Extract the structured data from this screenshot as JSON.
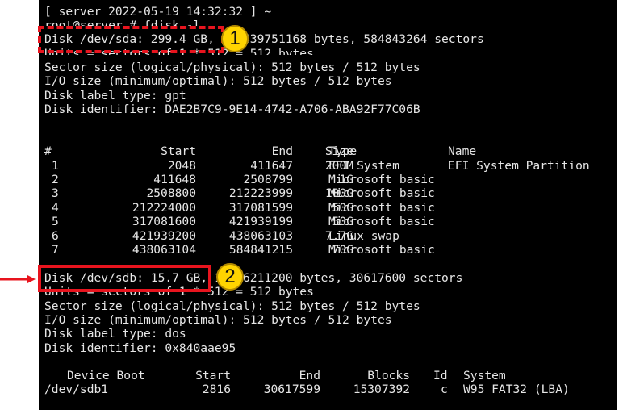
{
  "terminal": {
    "prompt_line": "[ server 2022-05-19 14:32:32 ] ~",
    "command_line": "root@server # fdisk -l",
    "sda": {
      "disk_line": "Disk /dev/sda: 299.4 GB, 299439751168 bytes, 584843264 sectors",
      "units_line": "Units = sectors of 1 * 512 = 512 bytes",
      "sector_size_line": "Sector size (logical/physical): 512 bytes / 512 bytes",
      "io_size_line": "I/O size (minimum/optimal): 512 bytes / 512 bytes",
      "label_type_line": "Disk label type: gpt",
      "identifier_line": "Disk identifier: DAE2B7C9-9E14-4742-A706-ABA92F77C06B"
    },
    "partition_table": {
      "headers": [
        "#",
        "Start",
        "End",
        "Size",
        "Type",
        "Name"
      ],
      "rows": [
        [
          "1",
          "2048",
          "411647",
          "200M",
          "EFI System",
          "EFI System Partition"
        ],
        [
          "2",
          "411648",
          "2508799",
          "1G",
          "Microsoft basic",
          ""
        ],
        [
          "3",
          "2508800",
          "212223999",
          "100G",
          "Microsoft basic",
          ""
        ],
        [
          "4",
          "212224000",
          "317081599",
          "50G",
          "Microsoft basic",
          ""
        ],
        [
          "5",
          "317081600",
          "421939199",
          "50G",
          "Microsoft basic",
          ""
        ],
        [
          "6",
          "421939200",
          "438063103",
          "7.7G",
          "Linux swap",
          ""
        ],
        [
          "7",
          "438063104",
          "584841215",
          "70G",
          "Microsoft basic",
          ""
        ]
      ]
    },
    "sdb": {
      "disk_line": "Disk /dev/sdb: 15.7 GB, 15676211200 bytes, 30617600 sectors",
      "units_line": "Units = sectors of 1 * 512 = 512 bytes",
      "sector_size_line": "Sector size (logical/physical): 512 bytes / 512 bytes",
      "io_size_line": "I/O size (minimum/optimal): 512 bytes / 512 bytes",
      "label_type_line": "Disk label type: dos",
      "identifier_line": "Disk identifier: 0x840aae95"
    },
    "sdb_table": {
      "headers": [
        "Device Boot",
        "Start",
        "End",
        "Blocks",
        "Id",
        "System"
      ],
      "rows": [
        [
          "/dev/sdb1",
          "2816",
          "30617599",
          "15307392",
          "c",
          "W95 FAT32 (LBA)"
        ]
      ]
    }
  },
  "annotations": {
    "badge_1": "1",
    "badge_2": "2",
    "highlight_color": "#e8141e",
    "badge_color": "#ffd400"
  }
}
